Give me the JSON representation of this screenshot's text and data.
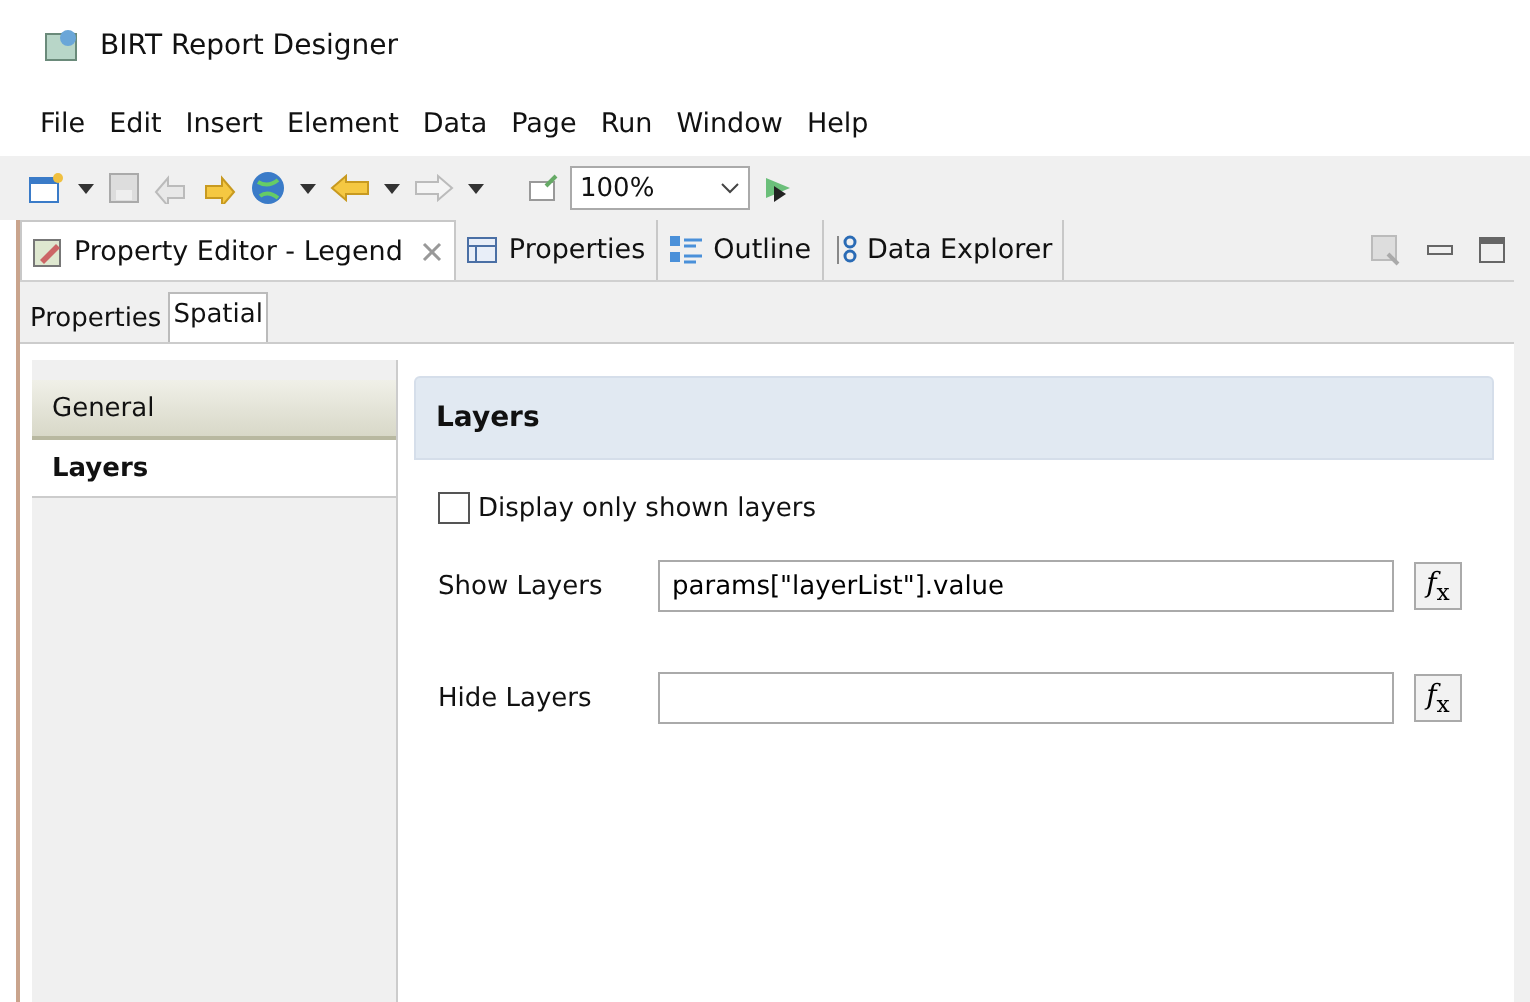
{
  "window": {
    "title": "BIRT Report Designer"
  },
  "menu": [
    "File",
    "Edit",
    "Insert",
    "Element",
    "Data",
    "Page",
    "Run",
    "Window",
    "Help"
  ],
  "toolbar": {
    "zoom": "100%"
  },
  "view_tabs": [
    {
      "label": "Property Editor - Legend",
      "selected": true,
      "closable": true,
      "kind": "editor"
    },
    {
      "label": "Properties",
      "selected": false,
      "kind": "table"
    },
    {
      "label": "Outline",
      "selected": false,
      "kind": "outline"
    },
    {
      "label": "Data Explorer",
      "selected": false,
      "kind": "data"
    }
  ],
  "sub_tabs": [
    {
      "label": "Properties",
      "selected": false
    },
    {
      "label": "Spatial",
      "selected": true
    }
  ],
  "sidebar": {
    "items": [
      {
        "label": "General",
        "selected": false
      },
      {
        "label": "Layers",
        "selected": true
      }
    ]
  },
  "section": {
    "title": "Layers",
    "checkbox": {
      "label": "Display only shown layers",
      "checked": false
    },
    "fields": [
      {
        "label": "Show Layers",
        "value": "params[\"layerList\"].value",
        "button": "*f*$_{x}$"
      },
      {
        "label": "Hide Layers",
        "button": "*f*$_{x}$"
      }
    ]
  }
}
